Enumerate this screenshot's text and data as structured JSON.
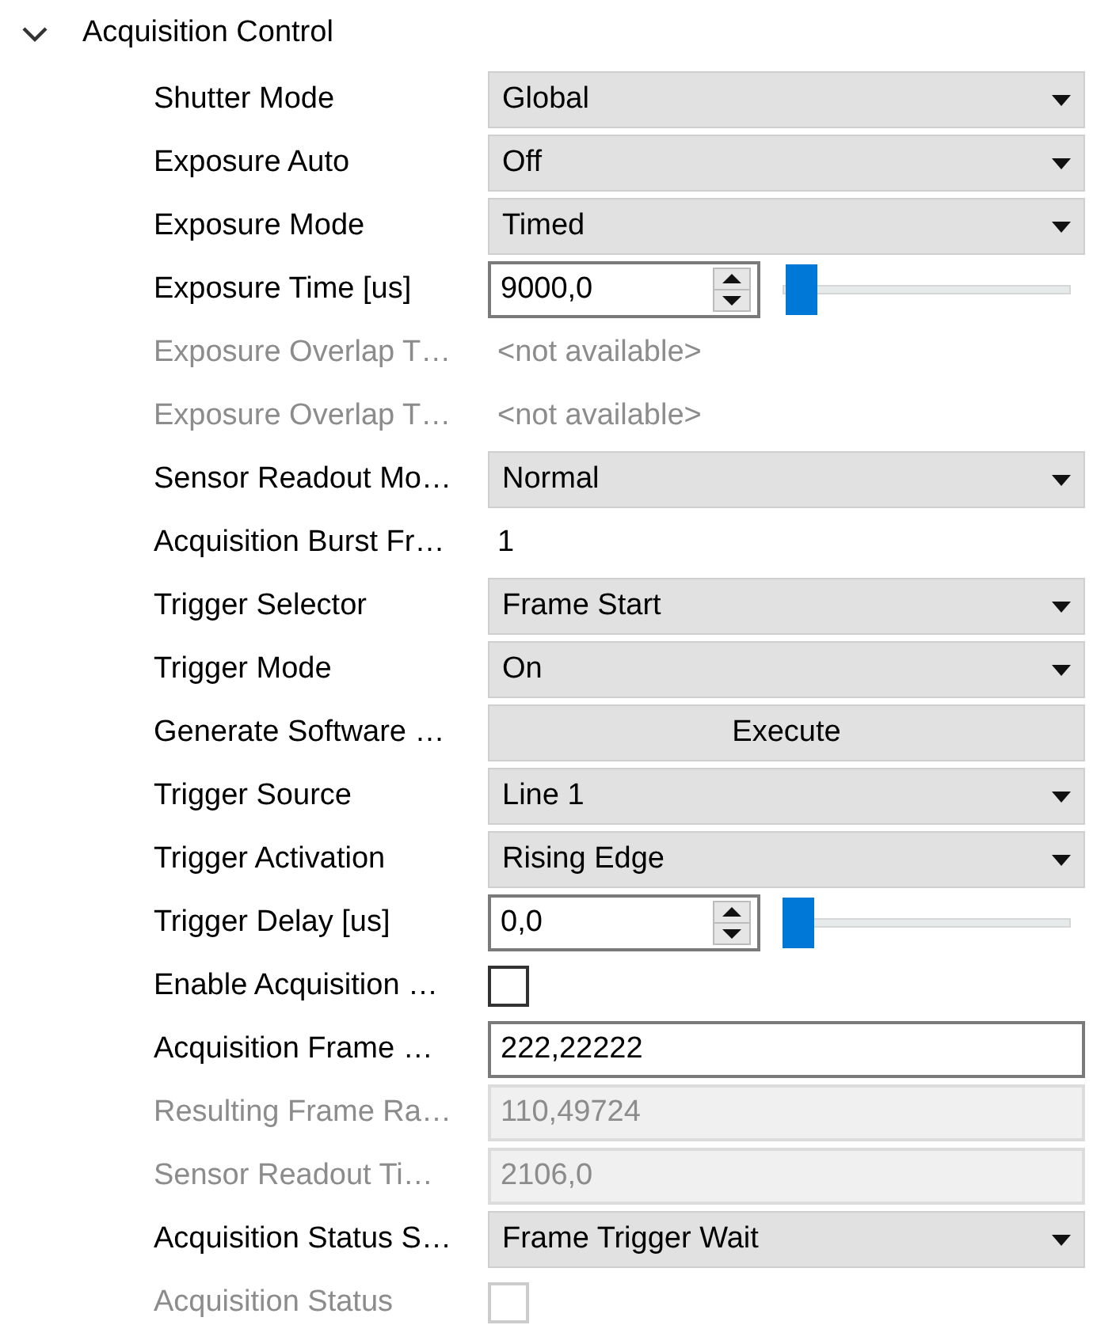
{
  "category": {
    "title": "Acquisition Control",
    "expanded": true
  },
  "features": [
    {
      "label": "Shutter Mode",
      "disabled": false,
      "kind": "dropdown",
      "value": "Global"
    },
    {
      "label": "Exposure Auto",
      "disabled": false,
      "kind": "dropdown",
      "value": "Off"
    },
    {
      "label": "Exposure Mode",
      "disabled": false,
      "kind": "dropdown",
      "value": "Timed"
    },
    {
      "label": "Exposure Time [us]",
      "disabled": false,
      "kind": "spin",
      "value": "9000,0",
      "level": 0.01
    },
    {
      "label": "Exposure Overlap T…",
      "disabled": true,
      "kind": "note",
      "value": "<not available>"
    },
    {
      "label": "Exposure Overlap T…",
      "disabled": true,
      "kind": "note",
      "value": "<not available>"
    },
    {
      "label": "Sensor Readout Mo…",
      "disabled": false,
      "kind": "dropdown",
      "value": "Normal"
    },
    {
      "label": "Acquisition Burst Fr…",
      "disabled": false,
      "kind": "note",
      "value": "1"
    },
    {
      "label": "Trigger Selector",
      "disabled": false,
      "kind": "dropdown",
      "value": "Frame Start"
    },
    {
      "label": "Trigger Mode",
      "disabled": false,
      "kind": "dropdown",
      "value": "On"
    },
    {
      "label": "Generate Software …",
      "disabled": false,
      "kind": "button",
      "value": "Execute"
    },
    {
      "label": "Trigger Source",
      "disabled": false,
      "kind": "dropdown",
      "value": "Line 1"
    },
    {
      "label": "Trigger Activation",
      "disabled": false,
      "kind": "dropdown",
      "value": "Rising Edge"
    },
    {
      "label": "Trigger Delay [us]",
      "disabled": false,
      "kind": "spin",
      "value": "0,0",
      "level": 0
    },
    {
      "label": "Enable Acquisition …",
      "disabled": false,
      "kind": "checkbox",
      "checked": false
    },
    {
      "label": "Acquisition Frame …",
      "disabled": false,
      "kind": "input",
      "value": "222,22222"
    },
    {
      "label": "Resulting Frame Ra…",
      "disabled": true,
      "kind": "input",
      "value": "110,49724"
    },
    {
      "label": "Sensor Readout Ti…",
      "disabled": true,
      "kind": "input",
      "value": "2106,0"
    },
    {
      "label": "Acquisition Status S…",
      "disabled": false,
      "kind": "dropdown",
      "value": "Frame Trigger Wait"
    },
    {
      "label": "Acquisition Status",
      "disabled": true,
      "kind": "checkbox",
      "checked": false
    }
  ]
}
